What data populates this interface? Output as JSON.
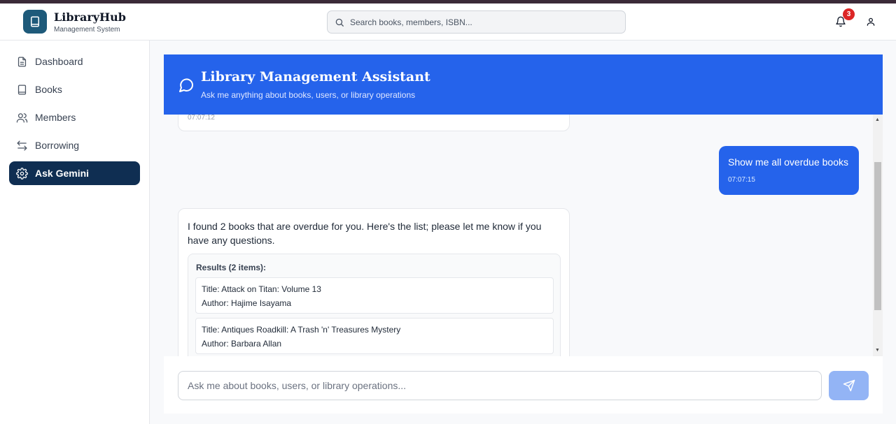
{
  "header": {
    "app_title": "LibraryHub",
    "app_subtitle": "Management System",
    "search_placeholder": "Search books, members, ISBN...",
    "notification_count": "3"
  },
  "sidebar": {
    "items": [
      {
        "label": "Dashboard",
        "icon": "document-icon"
      },
      {
        "label": "Books",
        "icon": "book-icon"
      },
      {
        "label": "Members",
        "icon": "users-icon"
      },
      {
        "label": "Borrowing",
        "icon": "arrows-icon"
      },
      {
        "label": "Ask Gemini",
        "icon": "gear-icon",
        "active": true
      }
    ]
  },
  "assistant": {
    "title": "Library Management Assistant",
    "subtitle": "Ask me anything about books, users, or library operations"
  },
  "messages": {
    "prev_timestamp": "07:07:12",
    "user_message": "Show me all overdue books",
    "user_timestamp": "07:07:15",
    "ai_reply": "I found 2 books that are overdue for you.  Here's the list; please let me know if you have any questions.",
    "results_title": "Results (2 items):",
    "results": [
      {
        "title": "Title: Attack on Titan: Volume 13",
        "author": "Author: Hajime Isayama"
      },
      {
        "title": "Title: Antiques Roadkill: A Trash 'n' Treasures Mystery",
        "author": "Author: Barbara Allan"
      }
    ]
  },
  "composer": {
    "placeholder": "Ask me about books, users, or library operations..."
  },
  "colors": {
    "primary": "#2563eb",
    "sidebar_active": "#0f2e52",
    "badge": "#dc2626"
  }
}
